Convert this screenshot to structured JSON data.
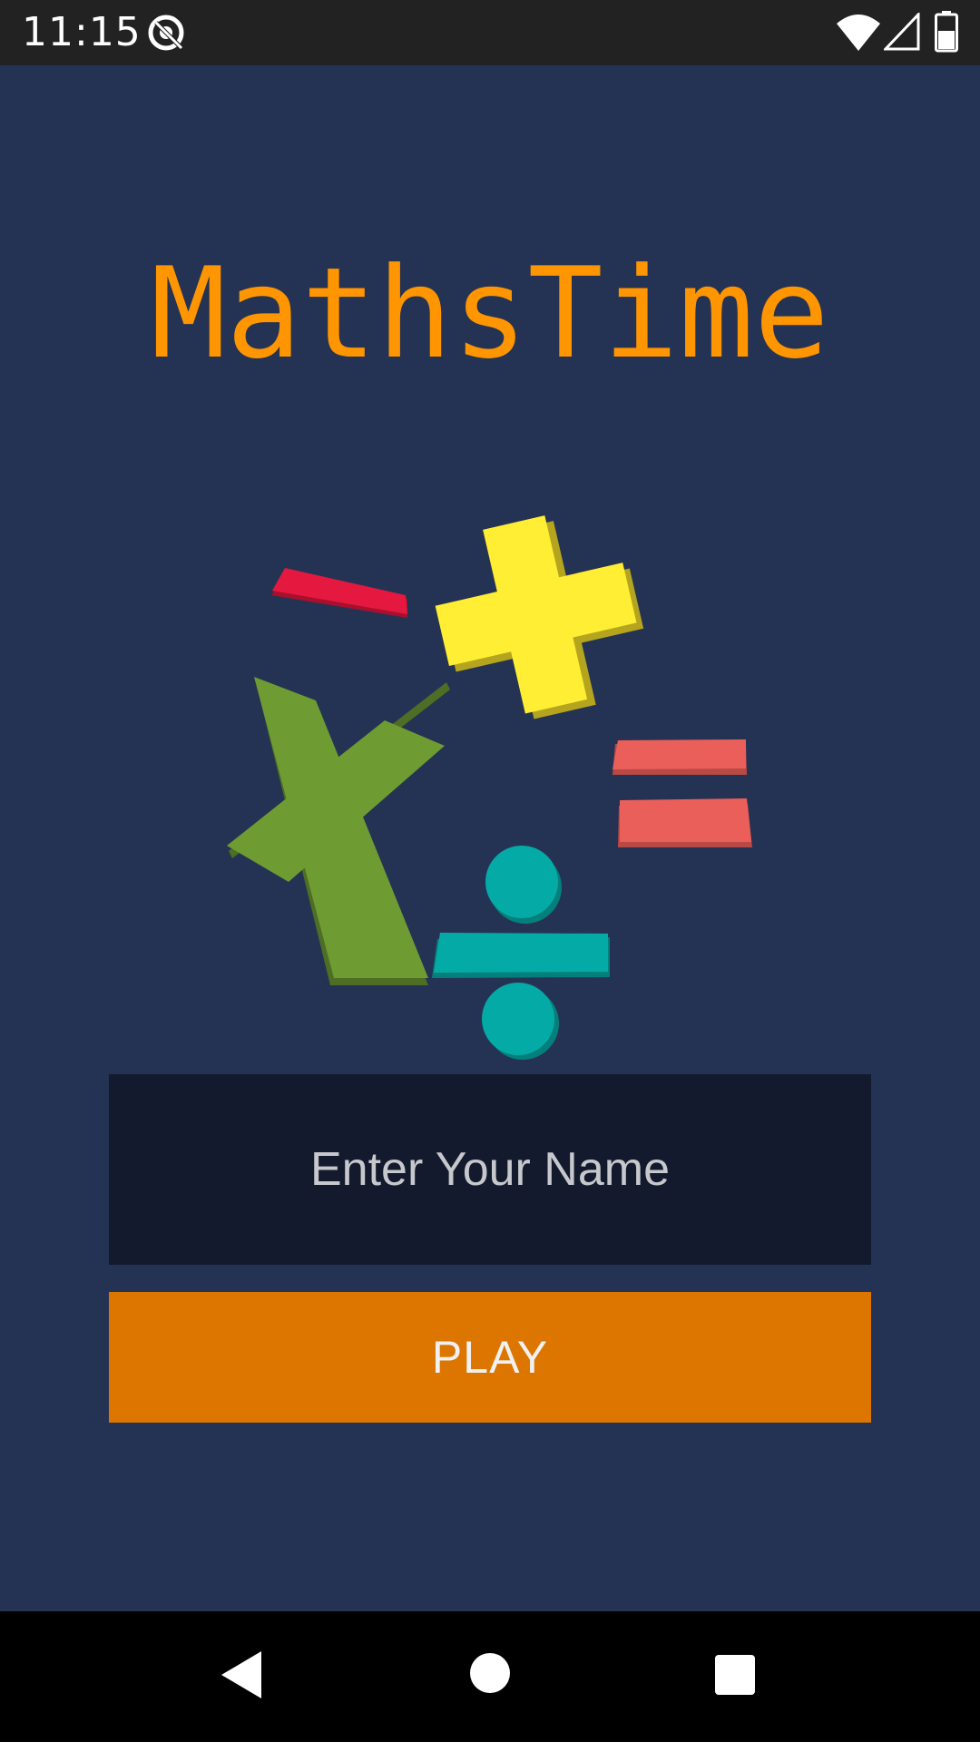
{
  "status_bar": {
    "time": "11:15",
    "icons": [
      "app-notification-icon",
      "wifi-icon",
      "cell-signal-icon",
      "battery-icon"
    ]
  },
  "main": {
    "title": "MathsTime",
    "logo_icon": "math-operators-logo",
    "name_input": {
      "placeholder": "Enter Your Name",
      "value": ""
    },
    "play_label": "PLAY"
  },
  "nav_bar": {
    "icons": [
      "back-icon",
      "home-icon",
      "recents-icon"
    ]
  },
  "colors": {
    "background": "#243353",
    "title": "#ff9500",
    "input_background": "#131a2e",
    "play_button": "#dc7600",
    "minus": "#e5183f",
    "plus": "#ffee33",
    "times": "#6e9b32",
    "divide": "#04aaa5",
    "equals": "#ea5f5a"
  }
}
